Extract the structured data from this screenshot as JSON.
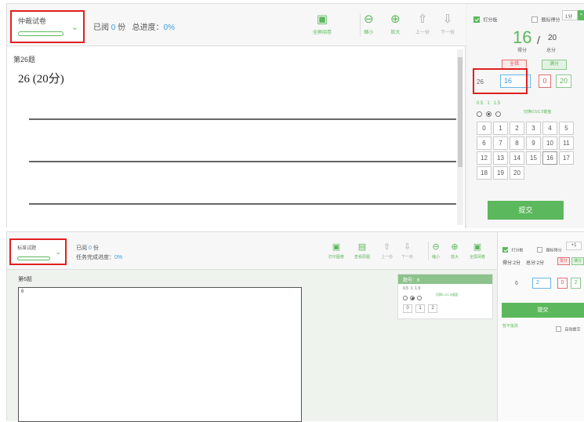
{
  "top": {
    "selector": {
      "label": "仲裁试卷"
    },
    "status": {
      "read_prefix": "已阅",
      "read_count": "0",
      "read_suffix": "份",
      "progress_label": "总进度：",
      "progress_value": "0%"
    },
    "toolbar": {
      "fullscreen": "全屏阅卷",
      "zoom_out": "缩小",
      "zoom_in": "放大",
      "prev": "上一份",
      "next": "下一份"
    },
    "question": {
      "number_label": "第26题",
      "title": "26 (20分)"
    },
    "side": {
      "score_panel_label": "打分板",
      "mark_score_label": "题标得分",
      "step_value": "1分",
      "score": "16",
      "slash": "/",
      "total": "20",
      "score_label": "得分",
      "total_label": "总分",
      "wrong_btn": "全错",
      "full_btn": "满分",
      "qnum": "26",
      "input_value": "16",
      "min": "0",
      "max": "20",
      "step_opts": [
        "0.5",
        "1",
        "1.5"
      ],
      "switch_label": "切换0.5/1.5键盘",
      "keys": [
        "0",
        "1",
        "2",
        "3",
        "4",
        "5",
        "6",
        "7",
        "8",
        "9",
        "10",
        "11",
        "12",
        "13",
        "14",
        "15",
        "16",
        "17",
        "18",
        "19",
        "20"
      ],
      "submit": "提交"
    }
  },
  "bottom": {
    "selector": {
      "label": "标准试题"
    },
    "status": {
      "read_prefix": "已阅",
      "read_count": "0",
      "read_suffix": "份",
      "progress_label": "任务完成进度：",
      "progress_value": "0%"
    },
    "toolbar": {
      "print": "打印图卷",
      "view_original": "查看原图",
      "prev": "上一份",
      "next": "下一份",
      "zoom_out": "缩小",
      "zoom_in": "放大",
      "fullscreen": "全屏阅卷"
    },
    "question": {
      "number_label": "第6题",
      "answer_text": "6"
    },
    "popup": {
      "title": "题号：6",
      "step_opts": [
        "0.5",
        "1",
        "1.5"
      ],
      "switch_label": "切换0.5/1.5键盘",
      "keys": [
        "0",
        "1",
        "2"
      ]
    },
    "side": {
      "score_panel_label": "打分板",
      "mark_score_label": "题标得分",
      "step_value": "+1",
      "score_text": "得分:2分",
      "total_text": "总分:2分",
      "wrong_btn": "零分",
      "full_btn": "满分",
      "qnum": "6",
      "input_value": "2",
      "min": "0",
      "max": "2",
      "submit": "提交",
      "no_review": "暂不批改",
      "auto_submit": "自动提交"
    }
  },
  "colors": {
    "accent": "#5cb85c",
    "highlight": "#e02020",
    "link": "#3b9bdc"
  }
}
